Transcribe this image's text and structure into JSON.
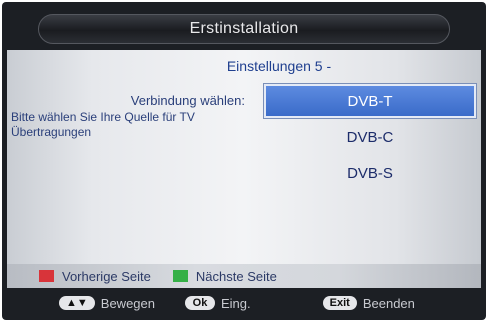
{
  "header": {
    "title": "Erstinstallation"
  },
  "main": {
    "subtitle": "Einstellungen 5 -",
    "prompt_label": "Verbindung wählen:",
    "hint": "Bitte wählen Sie Ihre Quelle für TV Übertragungen",
    "options": [
      {
        "label": "DVB-T",
        "selected": true
      },
      {
        "label": "DVB-C",
        "selected": false
      },
      {
        "label": "DVB-S",
        "selected": false
      }
    ]
  },
  "color_keys": {
    "red": {
      "label": "Vorherige Seite",
      "color": "#d8343a"
    },
    "green": {
      "label": "Nächste Seite",
      "color": "#35b047"
    }
  },
  "bottom_bar": {
    "move": {
      "key": "▲▼",
      "label": "Bewegen"
    },
    "ok": {
      "key": "Ok",
      "label": "Eing."
    },
    "exit": {
      "key": "Exit",
      "label": "Beenden"
    }
  },
  "colors": {
    "selection": "#3a6bc9",
    "text_blue": "#1f3f8f"
  }
}
